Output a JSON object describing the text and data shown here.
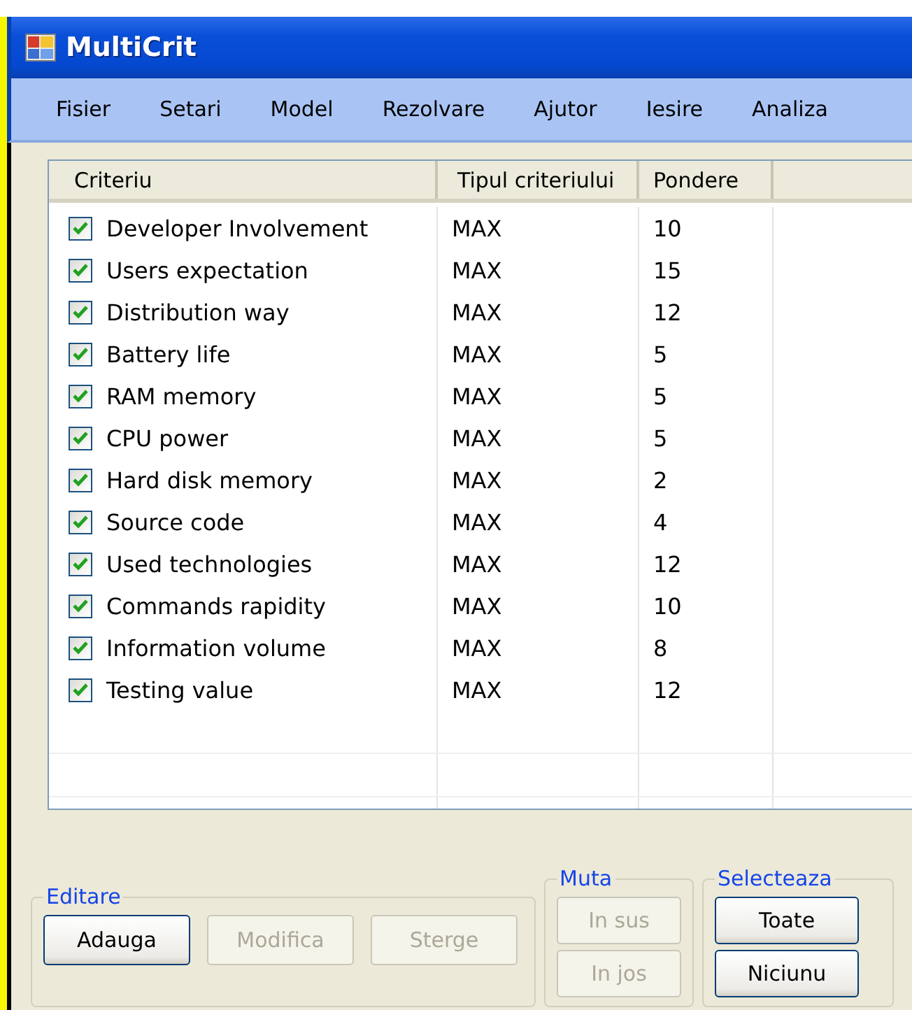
{
  "window": {
    "title": "MultiCrit"
  },
  "menu": [
    "Fisier",
    "Setari",
    "Model",
    "Rezolvare",
    "Ajutor",
    "Iesire",
    "Analiza"
  ],
  "table": {
    "columns": [
      "Criteriu",
      "Tipul criteriului",
      "Pondere"
    ],
    "rows": [
      {
        "checked": true,
        "name": "Developer Involvement",
        "type": "MAX",
        "weight": "10"
      },
      {
        "checked": true,
        "name": "Users expectation",
        "type": "MAX",
        "weight": "15"
      },
      {
        "checked": true,
        "name": "Distribution way",
        "type": "MAX",
        "weight": "12"
      },
      {
        "checked": true,
        "name": "Battery life",
        "type": "MAX",
        "weight": "5"
      },
      {
        "checked": true,
        "name": "RAM memory",
        "type": "MAX",
        "weight": "5"
      },
      {
        "checked": true,
        "name": "CPU power",
        "type": "MAX",
        "weight": "5"
      },
      {
        "checked": true,
        "name": "Hard disk memory",
        "type": "MAX",
        "weight": "2"
      },
      {
        "checked": true,
        "name": "Source code",
        "type": "MAX",
        "weight": "4"
      },
      {
        "checked": true,
        "name": "Used technologies",
        "type": "MAX",
        "weight": "12"
      },
      {
        "checked": true,
        "name": "Commands rapidity",
        "type": "MAX",
        "weight": "10"
      },
      {
        "checked": true,
        "name": "Information volume",
        "type": "MAX",
        "weight": "8"
      },
      {
        "checked": true,
        "name": "Testing value",
        "type": "MAX",
        "weight": "12"
      }
    ]
  },
  "groups": [
    {
      "title": "Editare",
      "buttons": [
        {
          "label": "Adauga",
          "disabled": false
        },
        {
          "label": "Modifica",
          "disabled": true
        },
        {
          "label": "Sterge",
          "disabled": true
        }
      ]
    },
    {
      "title": "Muta",
      "buttons": [
        {
          "label": "In sus",
          "disabled": true
        },
        {
          "label": "In jos",
          "disabled": true
        }
      ]
    },
    {
      "title": "Selecteaza",
      "buttons": [
        {
          "label": "Toate",
          "disabled": false
        },
        {
          "label": "Niciunu",
          "disabled": false
        }
      ]
    }
  ]
}
